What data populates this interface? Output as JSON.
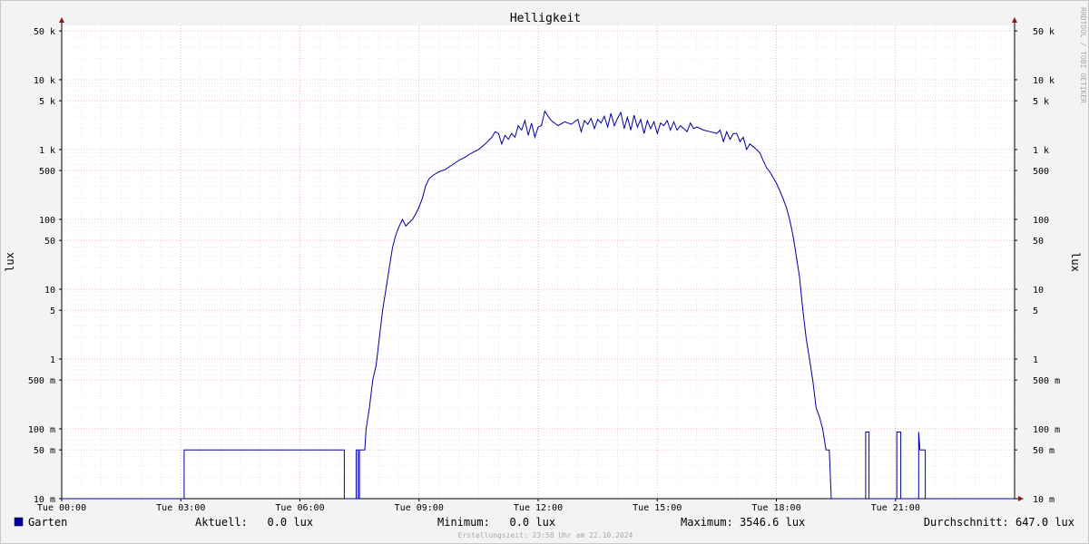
{
  "chart_data": {
    "type": "line",
    "title": "Helligkeit",
    "ylabel": "lux",
    "yscale": "log",
    "ylim": [
      0.01,
      60000
    ],
    "xlim": [
      "Tue 00:00",
      "Tue 24:00"
    ],
    "x_ticks": [
      "Tue 00:00",
      "Tue 03:00",
      "Tue 06:00",
      "Tue 09:00",
      "Tue 12:00",
      "Tue 15:00",
      "Tue 18:00",
      "Tue 21:00"
    ],
    "y_ticks": [
      {
        "value": 0.01,
        "label": "10 m"
      },
      {
        "value": 0.05,
        "label": "50 m"
      },
      {
        "value": 0.1,
        "label": "100 m"
      },
      {
        "value": 0.5,
        "label": "500 m"
      },
      {
        "value": 1,
        "label": "1"
      },
      {
        "value": 5,
        "label": "5"
      },
      {
        "value": 10,
        "label": "10"
      },
      {
        "value": 50,
        "label": "50"
      },
      {
        "value": 100,
        "label": "100"
      },
      {
        "value": 500,
        "label": "500"
      },
      {
        "value": 1000,
        "label": "1 k"
      },
      {
        "value": 5000,
        "label": "5 k"
      },
      {
        "value": 10000,
        "label": "10 k"
      },
      {
        "value": 50000,
        "label": "50 k"
      }
    ],
    "grid": true,
    "legend_position": "bottom",
    "series": [
      {
        "name": "Garten",
        "color": "#0000a0",
        "points": [
          [
            "00:00",
            0.01
          ],
          [
            "03:05",
            0.01
          ],
          [
            "03:05",
            0.05
          ],
          [
            "07:07",
            0.05
          ],
          [
            "07:07",
            0.01
          ],
          [
            "07:25",
            0.01
          ],
          [
            "07:25",
            0.05
          ],
          [
            "07:28",
            0.05
          ],
          [
            "07:28",
            0.01
          ],
          [
            "07:30",
            0.01
          ],
          [
            "07:30",
            0.05
          ],
          [
            "07:38",
            0.05
          ],
          [
            "07:40",
            0.1
          ],
          [
            "07:45",
            0.2
          ],
          [
            "07:50",
            0.5
          ],
          [
            "07:55",
            0.8
          ],
          [
            "08:00",
            2
          ],
          [
            "08:05",
            5
          ],
          [
            "08:10",
            10
          ],
          [
            "08:15",
            20
          ],
          [
            "08:20",
            40
          ],
          [
            "08:25",
            60
          ],
          [
            "08:30",
            80
          ],
          [
            "08:35",
            100
          ],
          [
            "08:40",
            80
          ],
          [
            "08:45",
            90
          ],
          [
            "08:50",
            100
          ],
          [
            "08:55",
            120
          ],
          [
            "09:00",
            150
          ],
          [
            "09:05",
            200
          ],
          [
            "09:10",
            300
          ],
          [
            "09:15",
            380
          ],
          [
            "09:20",
            420
          ],
          [
            "09:30",
            480
          ],
          [
            "09:40",
            520
          ],
          [
            "09:50",
            600
          ],
          [
            "10:00",
            700
          ],
          [
            "10:10",
            780
          ],
          [
            "10:20",
            900
          ],
          [
            "10:30",
            1000
          ],
          [
            "10:40",
            1200
          ],
          [
            "10:50",
            1500
          ],
          [
            "10:55",
            1800
          ],
          [
            "11:00",
            1700
          ],
          [
            "11:05",
            1200
          ],
          [
            "11:10",
            1600
          ],
          [
            "11:15",
            1400
          ],
          [
            "11:20",
            1700
          ],
          [
            "11:25",
            1500
          ],
          [
            "11:30",
            2200
          ],
          [
            "11:35",
            1900
          ],
          [
            "11:40",
            2600
          ],
          [
            "11:45",
            1600
          ],
          [
            "11:50",
            2400
          ],
          [
            "11:55",
            1500
          ],
          [
            "12:00",
            2100
          ],
          [
            "12:05",
            2200
          ],
          [
            "12:10",
            3546.6
          ],
          [
            "12:15",
            3000
          ],
          [
            "12:20",
            2600
          ],
          [
            "12:30",
            2200
          ],
          [
            "12:40",
            2500
          ],
          [
            "12:50",
            2300
          ],
          [
            "13:00",
            2700
          ],
          [
            "13:05",
            1800
          ],
          [
            "13:10",
            2600
          ],
          [
            "13:15",
            2300
          ],
          [
            "13:20",
            2800
          ],
          [
            "13:25",
            2000
          ],
          [
            "13:30",
            2700
          ],
          [
            "13:35",
            2400
          ],
          [
            "13:40",
            3000
          ],
          [
            "13:45",
            2100
          ],
          [
            "13:50",
            3300
          ],
          [
            "13:55",
            2200
          ],
          [
            "14:00",
            2800
          ],
          [
            "14:05",
            3400
          ],
          [
            "14:10",
            2000
          ],
          [
            "14:15",
            2900
          ],
          [
            "14:20",
            1900
          ],
          [
            "14:25",
            3100
          ],
          [
            "14:30",
            2100
          ],
          [
            "14:35",
            2700
          ],
          [
            "14:40",
            1700
          ],
          [
            "14:45",
            2600
          ],
          [
            "14:50",
            2000
          ],
          [
            "14:55",
            2500
          ],
          [
            "15:00",
            1700
          ],
          [
            "15:05",
            2400
          ],
          [
            "15:10",
            2200
          ],
          [
            "15:15",
            2600
          ],
          [
            "15:20",
            1900
          ],
          [
            "15:25",
            2500
          ],
          [
            "15:30",
            1900
          ],
          [
            "15:35",
            2200
          ],
          [
            "15:40",
            2000
          ],
          [
            "15:45",
            1800
          ],
          [
            "15:50",
            2400
          ],
          [
            "15:55",
            2000
          ],
          [
            "16:00",
            2100
          ],
          [
            "16:10",
            1900
          ],
          [
            "16:20",
            1800
          ],
          [
            "16:30",
            1700
          ],
          [
            "16:35",
            1900
          ],
          [
            "16:40",
            1300
          ],
          [
            "16:45",
            1800
          ],
          [
            "16:50",
            1400
          ],
          [
            "16:55",
            1700
          ],
          [
            "17:00",
            1700
          ],
          [
            "17:05",
            1300
          ],
          [
            "17:10",
            1500
          ],
          [
            "17:15",
            1000
          ],
          [
            "17:20",
            1200
          ],
          [
            "17:25",
            1100
          ],
          [
            "17:30",
            1000
          ],
          [
            "17:35",
            900
          ],
          [
            "17:40",
            700
          ],
          [
            "17:45",
            550
          ],
          [
            "17:50",
            480
          ],
          [
            "17:55",
            400
          ],
          [
            "18:00",
            330
          ],
          [
            "18:05",
            260
          ],
          [
            "18:10",
            200
          ],
          [
            "18:15",
            150
          ],
          [
            "18:20",
            100
          ],
          [
            "18:25",
            60
          ],
          [
            "18:30",
            30
          ],
          [
            "18:35",
            15
          ],
          [
            "18:40",
            5
          ],
          [
            "18:45",
            2
          ],
          [
            "18:50",
            1
          ],
          [
            "18:55",
            0.5
          ],
          [
            "19:00",
            0.2
          ],
          [
            "19:05",
            0.15
          ],
          [
            "19:10",
            0.1
          ],
          [
            "19:15",
            0.05
          ],
          [
            "19:20",
            0.05
          ],
          [
            "19:23",
            0.01
          ],
          [
            "20:15",
            0.01
          ],
          [
            "20:15",
            0.09
          ],
          [
            "20:20",
            0.09
          ],
          [
            "20:20",
            0.01
          ],
          [
            "21:02",
            0.01
          ],
          [
            "21:02",
            0.09
          ],
          [
            "21:08",
            0.09
          ],
          [
            "21:08",
            0.01
          ],
          [
            "21:35",
            0.01
          ],
          [
            "21:35",
            0.09
          ],
          [
            "21:37",
            0.05
          ],
          [
            "21:45",
            0.05
          ],
          [
            "21:45",
            0.01
          ],
          [
            "24:00",
            0.01
          ]
        ]
      }
    ]
  },
  "side_label": "RRDTOOL / TOBI OETIKER",
  "legend": {
    "series_name": "Garten",
    "color": "#0000a0",
    "aktuell": "Aktuell:   0.0 lux",
    "minimum": "Minimum:   0.0 lux",
    "maximum": "Maximum: 3546.6 lux",
    "durchschnitt": "Durchschnitt: 647.0 lux"
  },
  "footer": "Erstellungszeit: 23:58 Uhr am 22.10.2024"
}
